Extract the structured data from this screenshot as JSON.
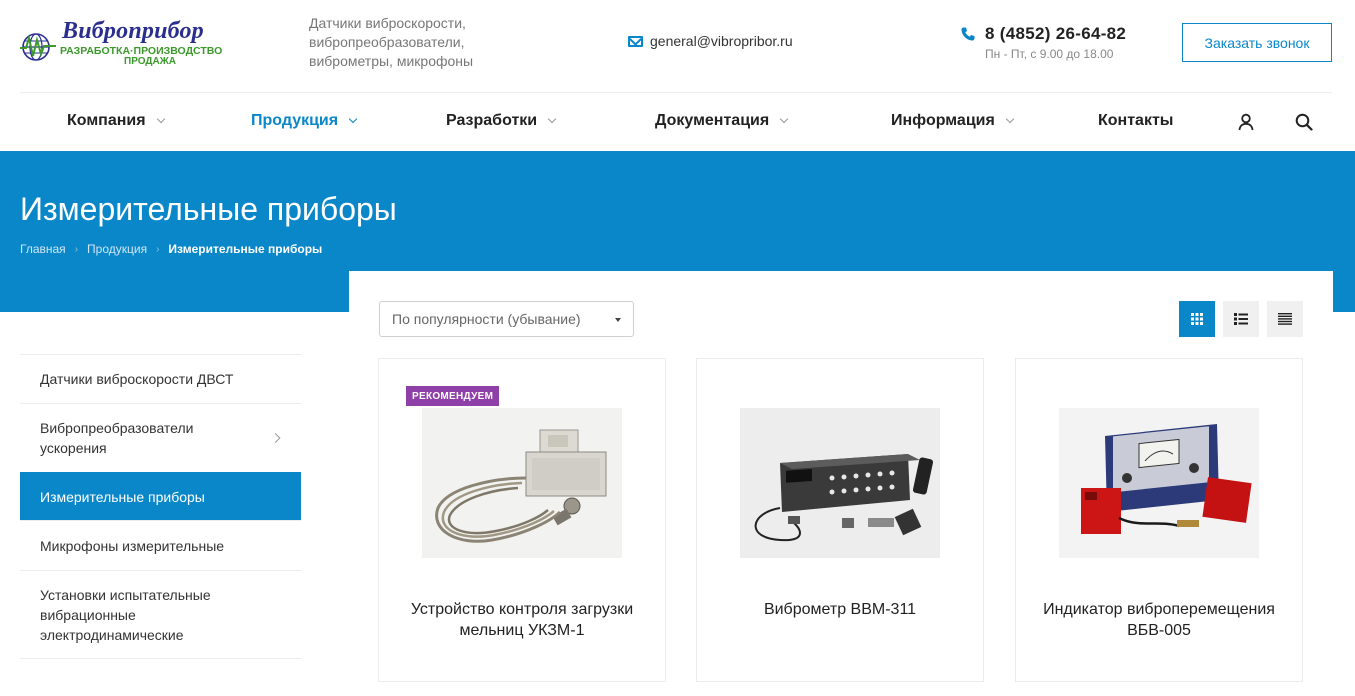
{
  "header": {
    "logo": {
      "brand": "Виброприбор",
      "tagline_line1": "РАЗРАБОТКА·ПРОИЗВОДСТВО",
      "tagline_line2": "ПРОДАЖА"
    },
    "slogan": [
      "Датчики виброскорости,",
      "вибропреобразователи,",
      "виброметры, микрофоны"
    ],
    "email": "general@vibropribor.ru",
    "phone": "8 (4852) 26-64-82",
    "hours": "Пн - Пт, с 9.00 до 18.00",
    "callback_label": "Заказать звонок"
  },
  "nav": {
    "items": [
      {
        "label": "Компания",
        "has_dropdown": true,
        "active": false
      },
      {
        "label": "Продукция",
        "has_dropdown": true,
        "active": true
      },
      {
        "label": "Разработки",
        "has_dropdown": true,
        "active": false
      },
      {
        "label": "Документация",
        "has_dropdown": true,
        "active": false
      },
      {
        "label": "Информация",
        "has_dropdown": true,
        "active": false
      },
      {
        "label": "Контакты",
        "has_dropdown": false,
        "active": false
      }
    ],
    "icons": [
      "user-icon",
      "search-icon"
    ]
  },
  "hero": {
    "title": "Измерительные приборы",
    "breadcrumb": [
      "Главная",
      "Продукция",
      "Измерительные приборы"
    ]
  },
  "sidebar": {
    "items": [
      {
        "label": "Датчики виброскорости ДВСТ",
        "active": false,
        "has_children": false
      },
      {
        "label": "Вибропреобразователи ускорения",
        "active": false,
        "has_children": true
      },
      {
        "label": "Измерительные приборы",
        "active": true,
        "has_children": false
      },
      {
        "label": "Микрофоны измерительные",
        "active": false,
        "has_children": false
      },
      {
        "label": "Установки испытательные вибрационные электродинамические",
        "active": false,
        "has_children": false
      }
    ]
  },
  "catalog": {
    "sort_value": "По популярности (убывание)",
    "view_modes": [
      "grid-view-icon",
      "list-view-icon",
      "table-view-icon"
    ],
    "active_view": "grid-view-icon",
    "products": [
      {
        "name": "Устройство контроля загрузки мельниц УКЗМ-1",
        "badge": "РЕКОМЕНДУЕМ"
      },
      {
        "name": "Виброметр ВВМ-311",
        "badge": ""
      },
      {
        "name": "Индикатор виброперемещения ВБВ-005",
        "badge": ""
      }
    ]
  },
  "colors": {
    "accent": "#0a87c9",
    "badge": "#8e3fa8",
    "logo_blue": "#2a2f8f",
    "logo_green": "#3c9a2c"
  }
}
